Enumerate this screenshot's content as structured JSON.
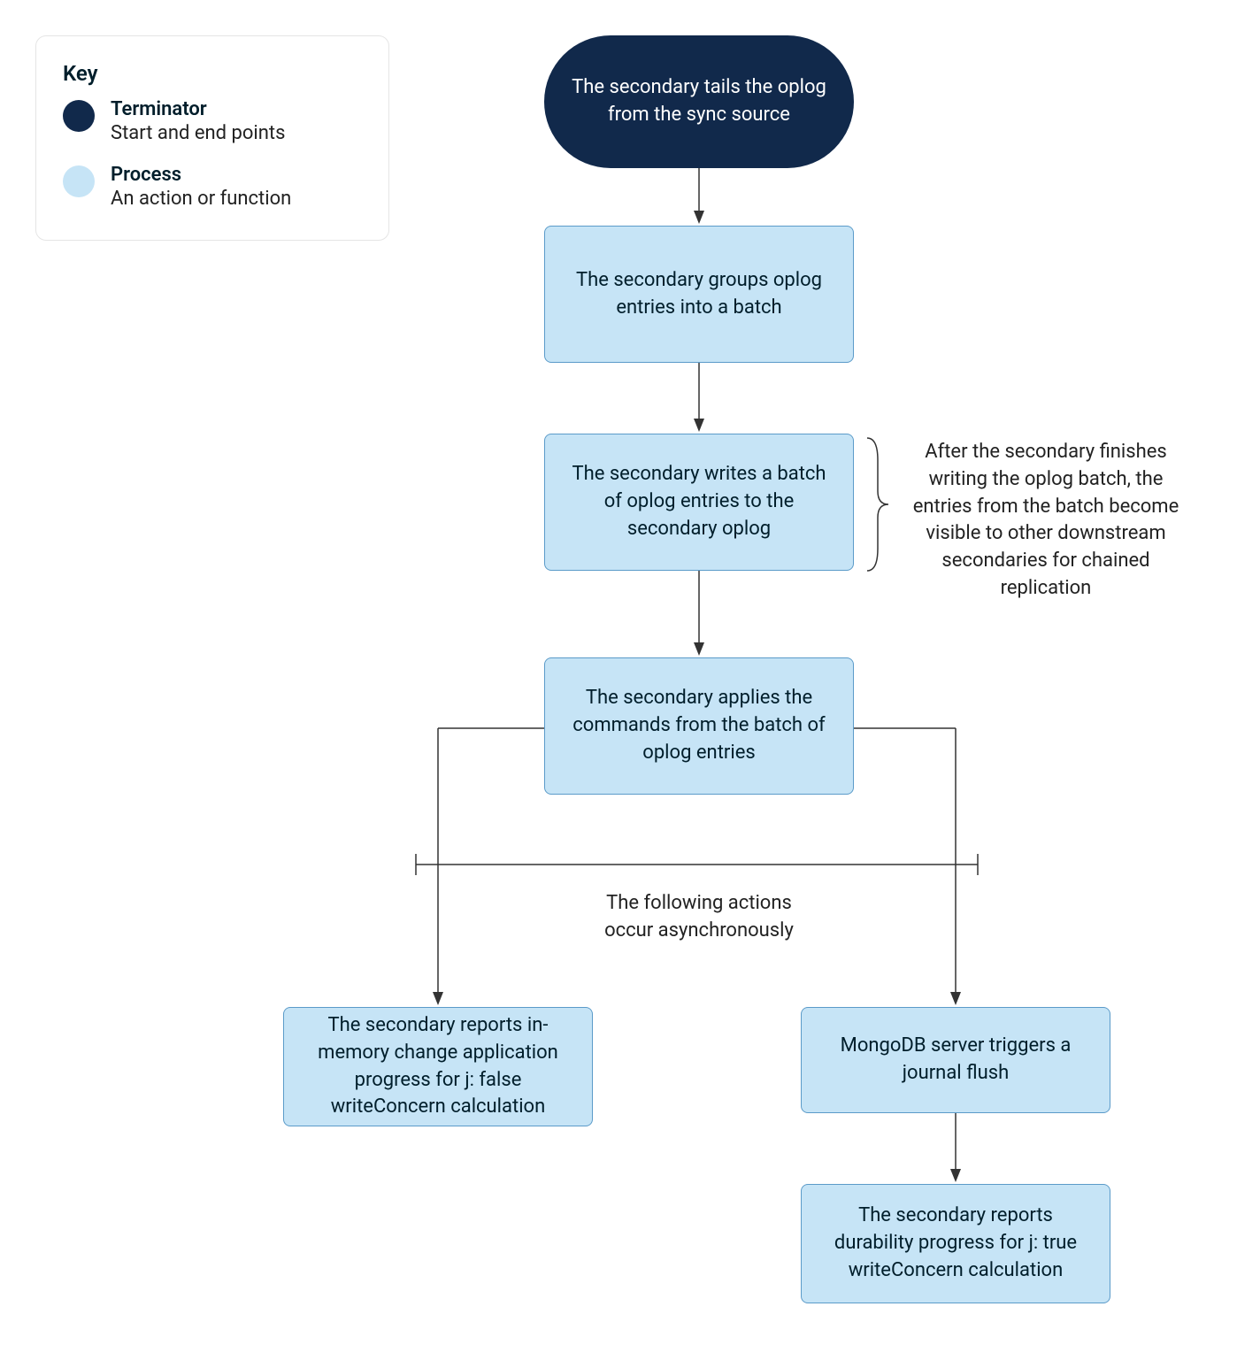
{
  "legend": {
    "title": "Key",
    "items": [
      {
        "label": "Terminator",
        "desc": "Start and end points"
      },
      {
        "label": "Process",
        "desc": "An action or function"
      }
    ]
  },
  "nodes": {
    "n1": "The secondary tails the oplog from the sync source",
    "n2": "The secondary groups oplog entries into a batch",
    "n3": "The secondary writes a batch of oplog entries to the secondary oplog",
    "n4": "The secondary applies the commands from the batch of oplog entries",
    "n5": "The secondary reports in-memory change application progress for j: false writeConcern calculation",
    "n6": "MongoDB server triggers a journal flush",
    "n7": "The secondary reports durability progress for j: true writeConcern calculation"
  },
  "annotations": {
    "a1": "After the secondary finishes writing the oplog batch, the entries from the batch become visible to other downstream secondaries for chained replication",
    "a2_line1": "The following actions",
    "a2_line2": "occur asynchronously"
  },
  "colors": {
    "terminator": "#11294B",
    "process": "#C6E4F6",
    "processBorder": "#5b9bc9",
    "arrow": "#333333"
  }
}
